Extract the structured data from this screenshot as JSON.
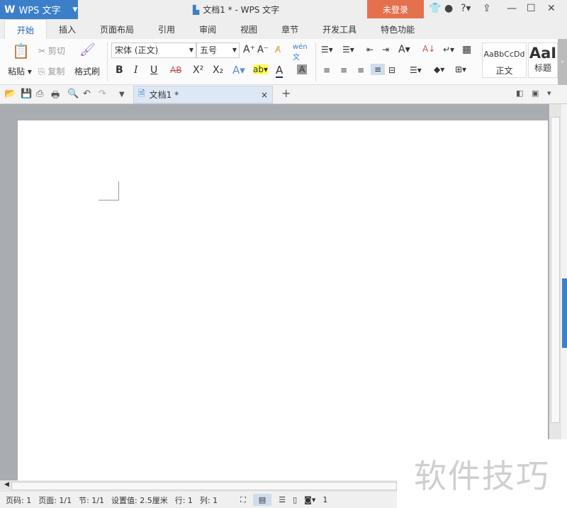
{
  "app": {
    "name": "WPS 文字",
    "logo": "W",
    "doc_title": "文档1 * - WPS 文字",
    "login": "未登录"
  },
  "tabs": [
    "开始",
    "插入",
    "页面布局",
    "引用",
    "审阅",
    "视图",
    "章节",
    "开发工具",
    "特色功能"
  ],
  "ribbon": {
    "paste": "粘贴",
    "cut": "剪切",
    "copy": "复制",
    "format_painter": "格式刷",
    "font": "宋体 (正文)",
    "size": "五号",
    "bold": "B",
    "italic": "I",
    "underline": "U",
    "strike": "AB",
    "sup": "X²",
    "sub": "X₂",
    "styles": [
      {
        "preview": "AaBbCcDd",
        "name": "正文"
      },
      {
        "preview": "AaI",
        "name": "标题"
      }
    ]
  },
  "doc_tab": {
    "label": "文档1 *",
    "close": "×",
    "new": "+"
  },
  "status": {
    "page_no": "页码: 1",
    "pages": "页面: 1/1",
    "section": "节: 1/1",
    "setting": "设置值: 2.5厘米",
    "row": "行: 1",
    "col": "列: 1",
    "zoom_partial": "1"
  },
  "watermark": "软件技巧",
  "colors": {
    "accent": "#3c7fc9",
    "login": "#e5704e"
  }
}
